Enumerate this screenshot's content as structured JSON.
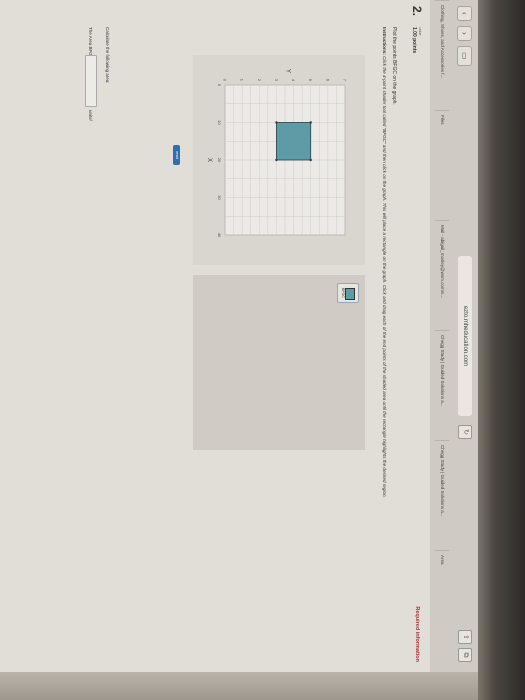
{
  "browser": {
    "url": "ezto.mheducation.com",
    "tabs": [
      "Clothing, Shoes, and Accessories f...",
      "Files",
      "Mail - abigail_mosley@wsm.comm...",
      "Chegg Study | Guided Solutions a...",
      "Chegg Study | Guided Solutions a...",
      "Area"
    ]
  },
  "question": {
    "number": "2.",
    "value_label": "value:",
    "points": "1.00 points",
    "required_info": "Required information",
    "prompt": "Plot the points BFGC on the graph.",
    "instructions_strong": "Instructions:",
    "instructions_text": " Click the 4-point shader tool called \"BFGC\" and then click on the graph. This will place a rectangle on the graph. Click and drag each of the end points of the shaded area until the rectangle highlights the desired region."
  },
  "graph": {
    "y_label": "Y",
    "x_label": "X",
    "y_ticks": [
      "7",
      "6",
      "5",
      "4",
      "3",
      "2",
      "1",
      "0"
    ],
    "x_ticks": [
      "0",
      "10",
      "20",
      "30",
      "40"
    ],
    "shaded_rect": {
      "x_from": 10,
      "x_to": 20,
      "y_from": 3,
      "y_to": 5
    },
    "shade_color": "#5d9ca6"
  },
  "tool": {
    "label": "BFGC"
  },
  "reset_label": "reset",
  "calc": {
    "prompt": "Calculate the following area:",
    "area_label": "The Area BFGC =",
    "unit": "units²"
  }
}
